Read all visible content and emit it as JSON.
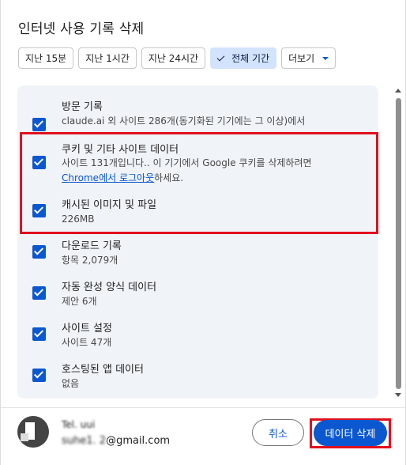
{
  "dialog": {
    "title": "인터넷 사용 기록 삭제"
  },
  "time_range": {
    "chips": [
      {
        "label": "지난 15분",
        "selected": false
      },
      {
        "label": "지난 1시간",
        "selected": false
      },
      {
        "label": "지난 24시간",
        "selected": false
      },
      {
        "label": "전체 기간",
        "selected": true
      }
    ],
    "more_label": "더보기"
  },
  "items": [
    {
      "title": "방문 기록",
      "subtitle": "claude.ai 외 사이트 286개(동기화된 기기에는 그 이상)에서",
      "checked": true
    },
    {
      "title": "쿠키 및 기타 사이트 데이터",
      "subtitle_line1": "사이트 131개입니다.. 이 기기에서 Google 쿠키를 삭제하려면",
      "subtitle_link": "Chrome에서 로그아웃",
      "subtitle_line2_suffix": "하세요.",
      "checked": true
    },
    {
      "title": "캐시된 이미지 및 파일",
      "subtitle": "226MB",
      "checked": true
    },
    {
      "title": "다운로드 기록",
      "subtitle": "항목 2,079개",
      "checked": true
    },
    {
      "title": "자동 완성 양식 데이터",
      "subtitle": "제안 6개",
      "checked": true
    },
    {
      "title": "사이트 설정",
      "subtitle": "사이트 47개",
      "checked": true
    },
    {
      "title": "호스팅된 앱 데이터",
      "subtitle": "없음",
      "checked": true
    }
  ],
  "account": {
    "name_masked": "Tel. uui",
    "email_masked_part": "suhe1. 2",
    "email_domain": "@gmail.com"
  },
  "actions": {
    "cancel_label": "취소",
    "delete_label": "데이터 삭제"
  },
  "colors": {
    "accent": "#0b57d0",
    "selected_chip_bg": "#d3e3fd",
    "list_bg": "#f0f4f9",
    "annotation_red": "#e0101e"
  }
}
